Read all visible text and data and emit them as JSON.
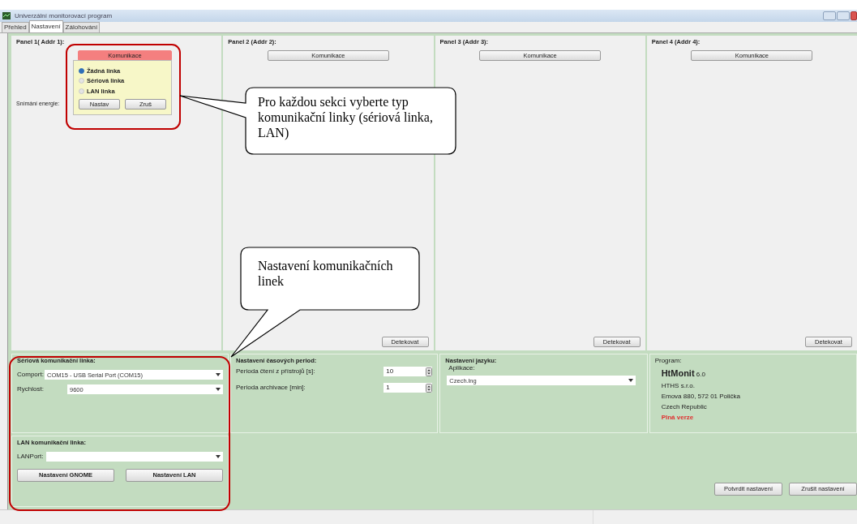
{
  "window": {
    "title": "Univerzální monitorovací program"
  },
  "tabs": [
    {
      "label": "Přehled",
      "selected": false
    },
    {
      "label": "Nastavení",
      "selected": true
    },
    {
      "label": "Zálohování",
      "selected": false
    }
  ],
  "panels": [
    {
      "title": "Panel 1( Addr 1):",
      "button": "Komunikace",
      "highlighted": true,
      "label": "Snímání energie:",
      "popup": {
        "options": [
          {
            "label": "Žádná linka",
            "selected": true
          },
          {
            "label": "Sériová linka",
            "selected": false
          },
          {
            "label": "LAN linka",
            "selected": false
          }
        ],
        "buttons": [
          "Nastav",
          "Zruš"
        ]
      }
    },
    {
      "title": "Panel 2 (Addr 2):",
      "button": "Komunikace",
      "highlighted": false,
      "detect": "Detekovat"
    },
    {
      "title": "Panel 3 (Addr 3):",
      "button": "Komunikace",
      "highlighted": false,
      "detect": "Detekovat"
    },
    {
      "title": "Panel 4 (Addr 4):",
      "button": "Komunikace",
      "highlighted": false,
      "detect": "Detekovat"
    }
  ],
  "serial": {
    "title": "Sériová komunikační linka:",
    "fields": [
      {
        "label": "Comport:",
        "value": "COM15 - USB Serial Port (COM15)"
      },
      {
        "label": "Rychlost:",
        "value": "9600"
      }
    ]
  },
  "lan": {
    "title": "LAN komunikační linka:",
    "field": {
      "label": "LANPort:"
    },
    "buttons": [
      "Nastavení GNOME",
      "Nastavení LAN"
    ]
  },
  "periods": {
    "title": "Nastavení časových period:",
    "fields": [
      {
        "label": "Perioda čtení z přístrojů [s]:",
        "value": "10"
      },
      {
        "label": "Perioda archivace [min]:",
        "value": "1"
      }
    ]
  },
  "language": {
    "title": "Nastavení jazyku:",
    "label": "Aplikace:",
    "value": "Czech.lng"
  },
  "program": {
    "title": "Program:",
    "name": "HtMonit",
    "version": "6.0",
    "lines": [
      "HTHS s.r.o.",
      "Emova 880, 572 01 Polička",
      "Czech Republic"
    ],
    "edition": "Plná verze"
  },
  "actions": [
    "Potvrdit nastavení",
    "Zrušit nastavení"
  ],
  "callouts": [
    {
      "text": "Pro každou sekci vyberte typ komunikační linky (sériová linka, LAN)"
    },
    {
      "text": "Nastavení komunikačních linek"
    }
  ]
}
